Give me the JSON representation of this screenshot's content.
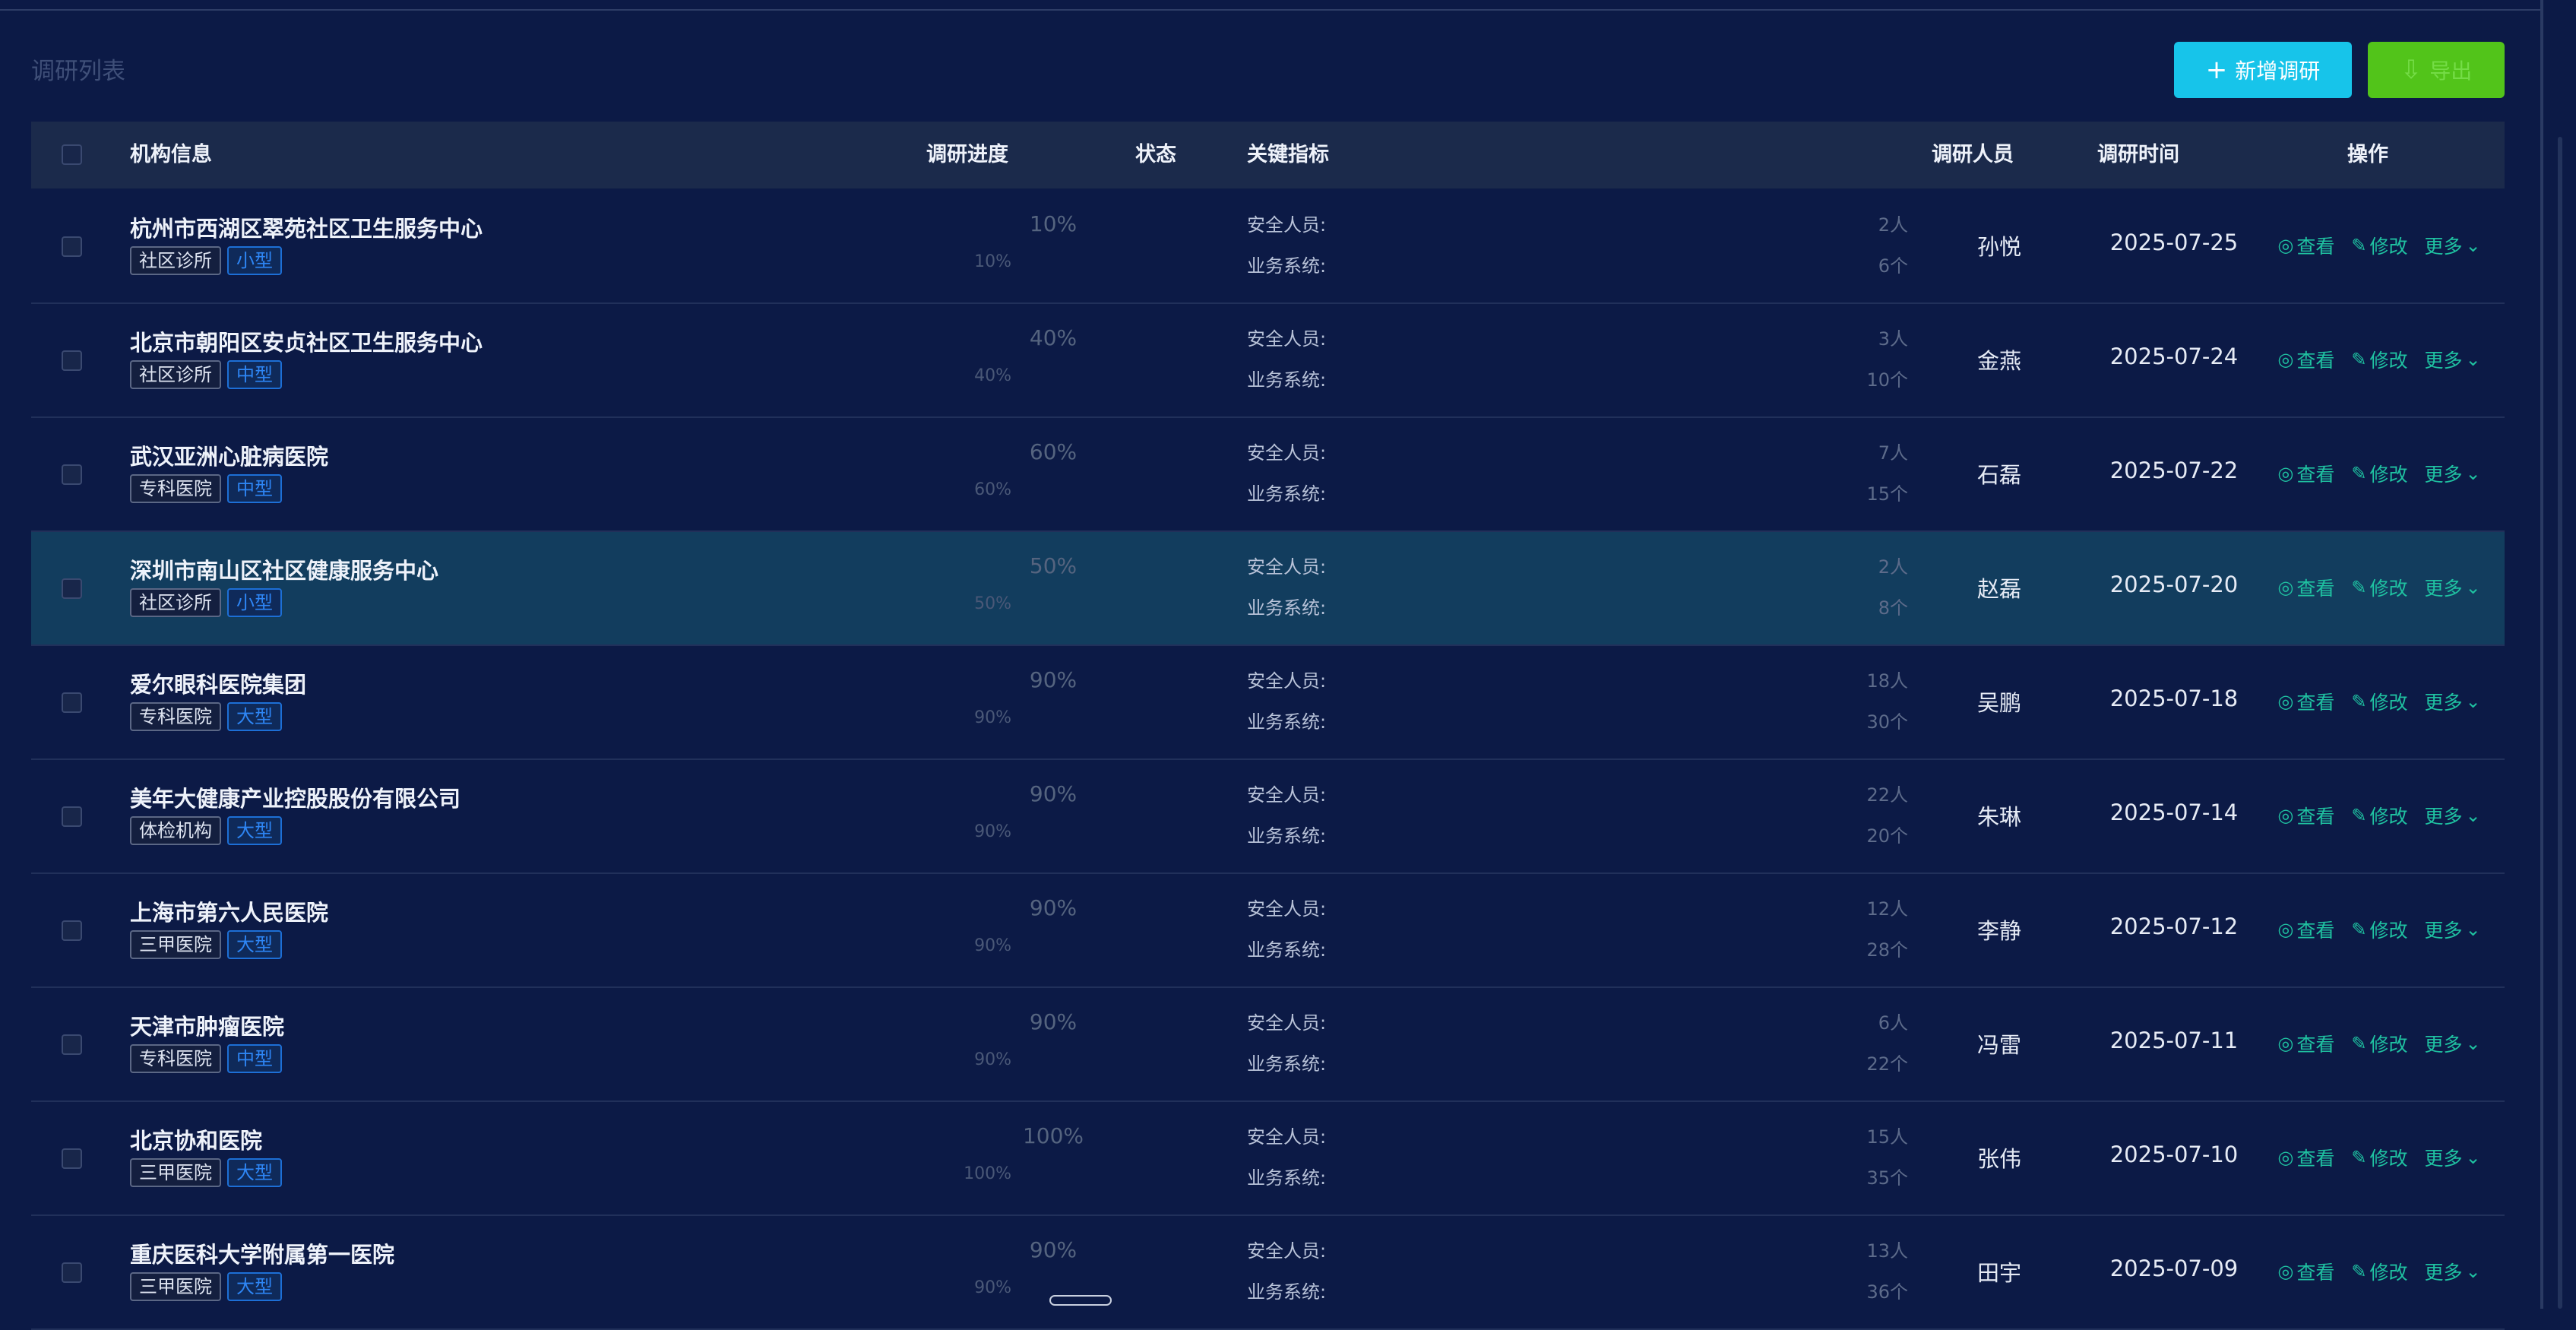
{
  "page": {
    "title": "调研列表"
  },
  "toolbar": {
    "add_label": "新增调研",
    "add_icon": "plus-icon",
    "export_label": "导出",
    "export_icon": "export-icon"
  },
  "table": {
    "headers": {
      "org": "机构信息",
      "progress": "调研进度",
      "status": "状态",
      "metrics": "关键指标",
      "person": "调研人员",
      "time": "调研时间",
      "ops": "操作"
    },
    "metric_labels": {
      "staff": "安全人员:",
      "systems": "业务系统:"
    },
    "op_labels": {
      "view": "查看",
      "edit": "修改",
      "more": "更多"
    },
    "rows": [
      {
        "name": "杭州市西湖区翠苑社区卫生服务中心",
        "type": "社区诊所",
        "size": "小型",
        "progress_top": "10%",
        "progress_bot": "10%",
        "staff": "2人",
        "systems": "6个",
        "person": "孙悦",
        "date": "2025-07-25"
      },
      {
        "name": "北京市朝阳区安贞社区卫生服务中心",
        "type": "社区诊所",
        "size": "中型",
        "progress_top": "40%",
        "progress_bot": "40%",
        "staff": "3人",
        "systems": "10个",
        "person": "金燕",
        "date": "2025-07-24"
      },
      {
        "name": "武汉亚洲心脏病医院",
        "type": "专科医院",
        "size": "中型",
        "progress_top": "60%",
        "progress_bot": "60%",
        "staff": "7人",
        "systems": "15个",
        "person": "石磊",
        "date": "2025-07-22"
      },
      {
        "name": "深圳市南山区社区健康服务中心",
        "type": "社区诊所",
        "size": "小型",
        "progress_top": "50%",
        "progress_bot": "50%",
        "staff": "2人",
        "systems": "8个",
        "person": "赵磊",
        "date": "2025-07-20"
      },
      {
        "name": "爱尔眼科医院集团",
        "type": "专科医院",
        "size": "大型",
        "progress_top": "90%",
        "progress_bot": "90%",
        "staff": "18人",
        "systems": "30个",
        "person": "吴鹏",
        "date": "2025-07-18"
      },
      {
        "name": "美年大健康产业控股股份有限公司",
        "type": "体检机构",
        "size": "大型",
        "progress_top": "90%",
        "progress_bot": "90%",
        "staff": "22人",
        "systems": "20个",
        "person": "朱琳",
        "date": "2025-07-14"
      },
      {
        "name": "上海市第六人民医院",
        "type": "三甲医院",
        "size": "大型",
        "progress_top": "90%",
        "progress_bot": "90%",
        "staff": "12人",
        "systems": "28个",
        "person": "李静",
        "date": "2025-07-12"
      },
      {
        "name": "天津市肿瘤医院",
        "type": "专科医院",
        "size": "中型",
        "progress_top": "90%",
        "progress_bot": "90%",
        "staff": "6人",
        "systems": "22个",
        "person": "冯雷",
        "date": "2025-07-11"
      },
      {
        "name": "北京协和医院",
        "type": "三甲医院",
        "size": "大型",
        "progress_top": "100%",
        "progress_bot": "100%",
        "staff": "15人",
        "systems": "35个",
        "person": "张伟",
        "date": "2025-07-10"
      },
      {
        "name": "重庆医科大学附属第一医院",
        "type": "三甲医院",
        "size": "大型",
        "progress_top": "90%",
        "progress_bot": "90%",
        "staff": "13人",
        "systems": "36个",
        "person": "田宇",
        "date": "2025-07-09"
      }
    ]
  },
  "colors": {
    "background": "#0c1a46",
    "header_bg": "#1b2a4b",
    "highlight_row": "#123d5e",
    "add_button": "#17c4ea",
    "export_button": "#52c41a",
    "op_link": "#1fc2a1",
    "size_tag": "#2e86f5"
  }
}
